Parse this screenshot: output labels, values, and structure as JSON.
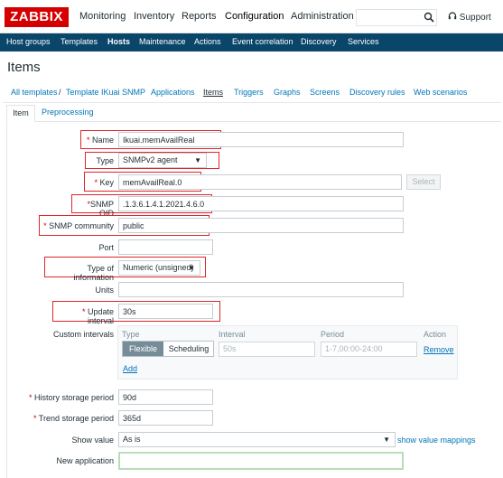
{
  "topbar": {
    "logo": "ZABBIX",
    "menu": [
      "Monitoring",
      "Inventory",
      "Reports",
      "Configuration",
      "Administration"
    ],
    "support": "Support",
    "search_placeholder": ""
  },
  "submenu": [
    "Host groups",
    "Templates",
    "Hosts",
    "Maintenance",
    "Actions",
    "Event correlation",
    "Discovery",
    "Services"
  ],
  "page_title": "Items",
  "breadcrumb": {
    "all_templates": "All templates",
    "separator": "/",
    "template": "Template IKuai SNMP",
    "tabs": [
      "Applications",
      "Items",
      "Triggers",
      "Graphs",
      "Screens",
      "Discovery rules",
      "Web scenarios"
    ]
  },
  "form_tabs": {
    "item": "Item",
    "preprocessing": "Preprocessing"
  },
  "form": {
    "name_label": "Name",
    "name_value": "Ikuai.memAvailReal",
    "type_label": "Type",
    "type_value": "SNMPv2 agent",
    "key_label": "Key",
    "key_value": "memAvailReal.0",
    "select_button": "Select",
    "oid_label": "SNMP OID",
    "oid_value": ".1.3.6.1.4.1.2021.4.6.0",
    "community_label": "SNMP community",
    "community_value": "public",
    "port_label": "Port",
    "port_value": "",
    "info_label": "Type of information",
    "info_value": "Numeric (unsigned)",
    "units_label": "Units",
    "units_value": "",
    "interval_label": "Update interval",
    "interval_value": "30s",
    "custom_label": "Custom intervals",
    "custom": {
      "col_type": "Type",
      "col_interval": "Interval",
      "col_period": "Period",
      "col_action": "Action",
      "flexible": "Flexible",
      "scheduling": "Scheduling",
      "interval_placeholder": "50s",
      "period_placeholder": "1-7,00:00-24:00",
      "remove": "Remove",
      "add": "Add"
    },
    "history_label": "History storage period",
    "history_value": "90d",
    "trend_label": "Trend storage period",
    "trend_value": "365d",
    "show_value_label": "Show value",
    "show_value_value": "As is",
    "show_value_link": "show value mappings",
    "new_app_label": "New application",
    "new_app_value": ""
  },
  "colors": {
    "brand": "#d40000",
    "nav": "#0a466a",
    "link": "#0275b8",
    "highlight": "#e0252b"
  },
  "icons": [
    "search-icon",
    "support-headset-icon",
    "chevron-down-icon"
  ]
}
